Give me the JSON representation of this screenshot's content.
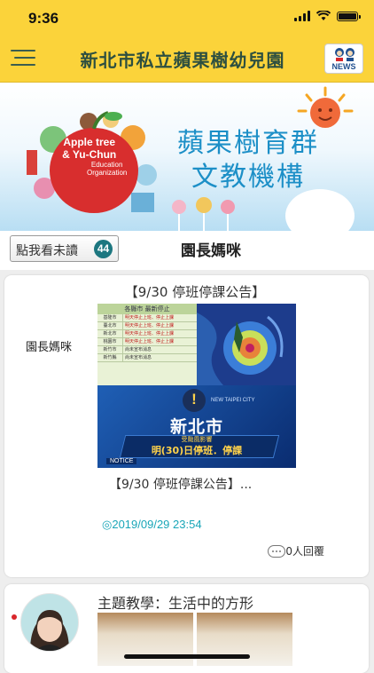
{
  "status_bar": {
    "time": "9:36"
  },
  "header": {
    "title": "新北市私立蘋果樹幼兒園",
    "news_label": "NEWS"
  },
  "banner": {
    "logo_line1": "Apple tree",
    "logo_line2": "& Yu-Chun",
    "logo_line3": "Education",
    "logo_line4": "Organization",
    "headline_line1": "蘋果樹育群",
    "headline_line2": "文教機構"
  },
  "subbar": {
    "unread_label": "點我看未讀",
    "unread_count": "44",
    "title": "園長媽咪"
  },
  "post": {
    "author": "園長媽咪",
    "title": "【9/30 停班停課公告】",
    "image": {
      "table_header": "各縣市 最新停止",
      "table_rows": [
        {
          "city": "基隆市",
          "status": "明天停止上班、停止上課"
        },
        {
          "city": "臺北市",
          "status": "明天停止上班、停止上課"
        },
        {
          "city": "新北市",
          "status": "明天停止上班、停止上課"
        },
        {
          "city": "桃園市",
          "status": "明天停止上班、停止上課"
        },
        {
          "city": "新竹市",
          "status": "尚未宣布消息"
        },
        {
          "city": "新竹縣",
          "status": "尚未宣布消息"
        }
      ],
      "notice_header": "NEW TAIPEI CITY",
      "city": "新北市",
      "strip_small": "受颱風影響",
      "strip_text": "明(30)日停班．停課",
      "notice_tag": "NOTICE"
    },
    "excerpt": "【9/30 停班停課公告】...",
    "date": "◎2019/09/29 23:54",
    "replies": "0人回覆"
  },
  "post2": {
    "title": "主題教學：生活中的方形"
  }
}
